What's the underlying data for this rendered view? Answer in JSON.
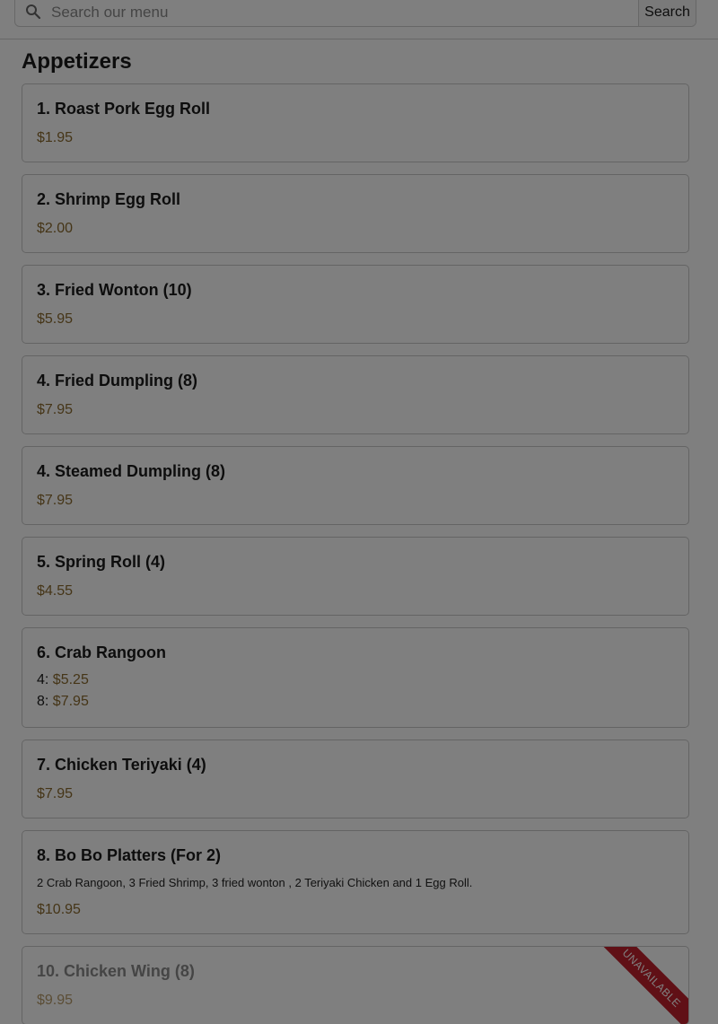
{
  "search": {
    "placeholder": "Search our menu",
    "button_label": "Search",
    "icon": "search-icon"
  },
  "category": {
    "title": "Appetizers"
  },
  "items": [
    {
      "name": "1. Roast Pork Egg Roll",
      "price": "$1.95"
    },
    {
      "name": "2. Shrimp Egg Roll",
      "price": "$2.00"
    },
    {
      "name": "3. Fried Wonton (10)",
      "price": "$5.95"
    },
    {
      "name": "4. Fried Dumpling (8)",
      "price": "$7.95"
    },
    {
      "name": "4. Steamed Dumpling (8)",
      "price": "$7.95"
    },
    {
      "name": "5. Spring Roll (4)",
      "price": "$4.55"
    },
    {
      "name": "6. Crab Rangoon",
      "prices": [
        {
          "size": "4:",
          "price": "$5.25"
        },
        {
          "size": "8:",
          "price": "$7.95"
        }
      ]
    },
    {
      "name": "7. Chicken Teriyaki (4)",
      "price": "$7.95"
    },
    {
      "name": "8. Bo Bo Platters (For 2)",
      "description": "2 Crab Rangoon, 3 Fried Shrimp, 3 fried wonton , 2 Teriyaki Chicken and 1 Egg Roll.",
      "price": "$10.95"
    },
    {
      "name": "10. Chicken Wing (8)",
      "price": "$9.95",
      "badge": "UNAVAILABLE"
    }
  ],
  "colors": {
    "price": "#8b6a2e",
    "badge": "#c0202c",
    "overlay": "rgba(0,0,0,0.5)"
  }
}
